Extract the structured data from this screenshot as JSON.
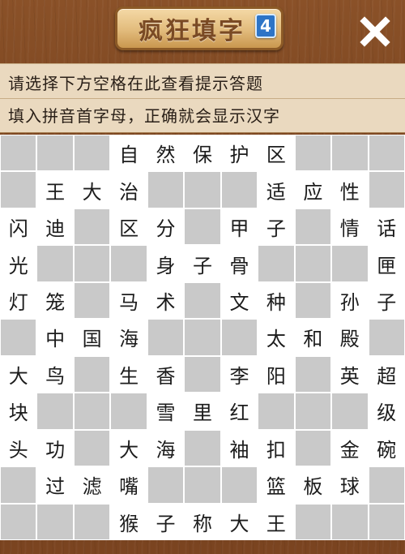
{
  "header": {
    "logo_text": "疯狂填字",
    "logo_number": "4",
    "close_icon": "close-x-icon"
  },
  "hint": {
    "line1": "请选择下方空格在此查看提示答题",
    "line2": "填入拼音首字母，正确就会显示汉字"
  },
  "colors": {
    "empty_cell": "#c9c9c9",
    "filled_cell": "#ffffff",
    "wood": "#7a4420",
    "hint_bg": "#ead9bf"
  },
  "grid": {
    "rows": [
      [
        "",
        "",
        "",
        "自",
        "然",
        "保",
        "护",
        "区",
        "",
        "",
        ""
      ],
      [
        "",
        "王",
        "大",
        "治",
        "",
        "",
        "",
        "适",
        "应",
        "性",
        ""
      ],
      [
        "闪",
        "迪",
        "",
        "区",
        "分",
        "",
        "甲",
        "子",
        "",
        "情",
        "话"
      ],
      [
        "光",
        "",
        "",
        "",
        "身",
        "子",
        "骨",
        "",
        "",
        "",
        "匣"
      ],
      [
        "灯",
        "笼",
        "",
        "马",
        "术",
        "",
        "文",
        "种",
        "",
        "孙",
        "子"
      ],
      [
        "",
        "中",
        "国",
        "海",
        "",
        "",
        "",
        "太",
        "和",
        "殿",
        ""
      ],
      [
        "大",
        "鸟",
        "",
        "生",
        "香",
        "",
        "李",
        "阳",
        "",
        "英",
        "超"
      ],
      [
        "块",
        "",
        "",
        "",
        "雪",
        "里",
        "红",
        "",
        "",
        "",
        "级"
      ],
      [
        "头",
        "功",
        "",
        "大",
        "海",
        "",
        "袖",
        "扣",
        "",
        "金",
        "碗"
      ],
      [
        "",
        "过",
        "滤",
        "嘴",
        "",
        "",
        "",
        "篮",
        "板",
        "球",
        ""
      ],
      [
        "",
        "",
        "",
        "猴",
        "子",
        "称",
        "大",
        "王",
        "",
        "",
        ""
      ]
    ]
  }
}
